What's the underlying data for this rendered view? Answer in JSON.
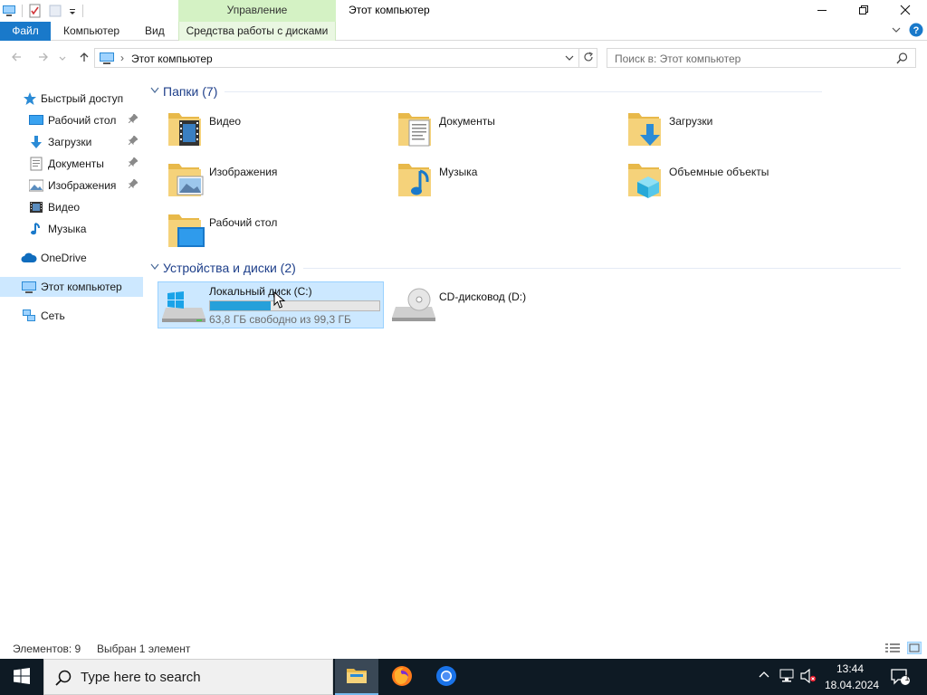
{
  "window": {
    "title": "Этот компьютер",
    "context_group": "Управление"
  },
  "ribbon": {
    "tabs": {
      "file": "Файл",
      "computer": "Компьютер",
      "view": "Вид",
      "disk_tools": "Средства работы с дисками"
    }
  },
  "address": {
    "breadcrumb": "Этот компьютер",
    "search_placeholder": "Поиск в: Этот компьютер"
  },
  "nav": {
    "quick_access": "Быстрый доступ",
    "items": [
      {
        "label": "Рабочий стол",
        "pinned": true,
        "icon": "desktop-icon"
      },
      {
        "label": "Загрузки",
        "pinned": true,
        "icon": "downloads-icon"
      },
      {
        "label": "Документы",
        "pinned": true,
        "icon": "documents-icon"
      },
      {
        "label": "Изображения",
        "pinned": true,
        "icon": "pictures-icon"
      },
      {
        "label": "Видео",
        "pinned": false,
        "icon": "video-icon"
      },
      {
        "label": "Музыка",
        "pinned": false,
        "icon": "music-icon"
      }
    ],
    "onedrive": "OneDrive",
    "this_pc": "Этот компьютер",
    "network": "Сеть"
  },
  "folders": {
    "header": "Папки (7)",
    "items": [
      {
        "label": "Видео",
        "icon": "video-folder-icon"
      },
      {
        "label": "Документы",
        "icon": "documents-folder-icon"
      },
      {
        "label": "Загрузки",
        "icon": "downloads-folder-icon"
      },
      {
        "label": "Изображения",
        "icon": "pictures-folder-icon"
      },
      {
        "label": "Музыка",
        "icon": "music-folder-icon"
      },
      {
        "label": "Объемные объекты",
        "icon": "3d-objects-folder-icon"
      },
      {
        "label": "Рабочий стол",
        "icon": "desktop-folder-icon"
      }
    ]
  },
  "devices": {
    "header": "Устройства и диски (2)",
    "drives": [
      {
        "label": "Локальный диск (C:)",
        "free_text": "63,8 ГБ свободно из 99,3 ГБ",
        "used_fraction": 0.357,
        "selected": true
      },
      {
        "label": "CD-дисковод (D:)"
      }
    ]
  },
  "status": {
    "count": "Элементов: 9",
    "selected": "Выбран 1 элемент"
  },
  "taskbar": {
    "search_placeholder": "Type here to search",
    "time": "13:44",
    "date": "18.04.2024",
    "notification_count": "1"
  },
  "colors": {
    "accent": "#1979ca",
    "selection": "#cce8ff",
    "drive_bar": "#26a0da",
    "taskbar": "#0e1a24"
  }
}
